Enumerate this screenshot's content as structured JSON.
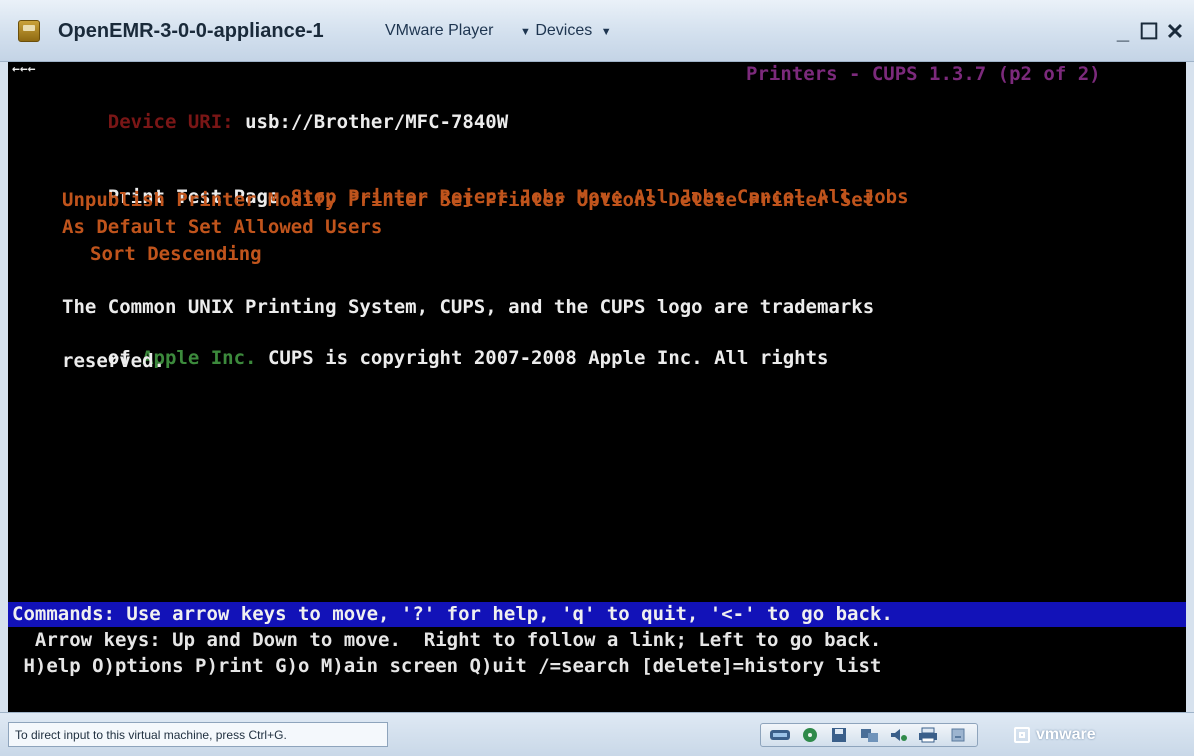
{
  "titlebar": {
    "vm_name": "OpenEMR-3-0-0-appliance-1",
    "menus": [
      {
        "label": "VMware Player"
      },
      {
        "label": "Devices"
      }
    ],
    "minimize_glyph": "_",
    "maximize_glyph": "☐",
    "close_glyph": "✕"
  },
  "terminal": {
    "back_marker": "←←←",
    "page_header": "Printers - CUPS 1.3.7 (p2 of 2)",
    "device_uri_label": "Device URI:",
    "device_uri_value": "usb://Brother/MFC-7840W",
    "actions_line1": {
      "active": "Print Test Page",
      "rest": "Stop Printer Reject Jobs Move All Jobs Cancel All Jobs"
    },
    "actions_line2": "Unpublish Printer Modify Printer Set Printer Options Delete Printer Set",
    "actions_line3": "As Default Set Allowed Users",
    "sort_link": "Sort Descending",
    "footer_line1": "The Common UNIX Printing System, CUPS, and the CUPS logo are trademarks",
    "footer_line2_prefix": "of",
    "footer_link": "Apple Inc.",
    "footer_line2_suffix": "CUPS is copyright 2007-2008 Apple Inc. All rights",
    "footer_line3": "reserved.",
    "status_bar": "Commands: Use arrow keys to move, '?' for help, 'q' to quit, '<-' to go back.",
    "help_line1": "  Arrow keys: Up and Down to move.  Right to follow a link; Left to go back.",
    "help_line2": " H)elp O)ptions P)rint G)o M)ain screen Q)uit /=search [delete]=history list"
  },
  "bottombar": {
    "hint": "To direct input to this virtual machine, press Ctrl+G.",
    "device_icons": [
      "network-icon",
      "cd-icon",
      "floppy-icon",
      "usb-icon",
      "sound-icon",
      "printer-icon",
      "hdd-icon"
    ],
    "brand": "vmware"
  },
  "colors": {
    "terminal_bg": "#000000",
    "status_bar_bg": "#1212b8",
    "link_orange": "#c0541c",
    "label_red": "#7a1616",
    "header_magenta": "#7c2a7c",
    "link_green": "#3c8a3c"
  }
}
